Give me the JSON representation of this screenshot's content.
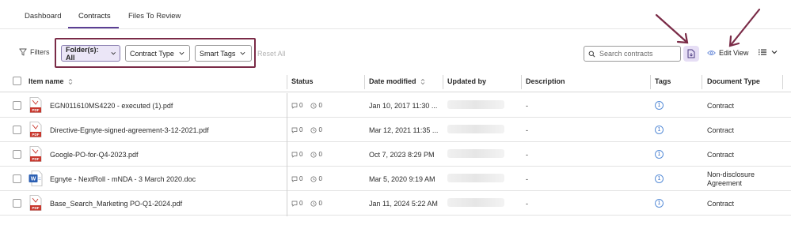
{
  "tabs": [
    {
      "label": "Dashboard"
    },
    {
      "label": "Contracts"
    },
    {
      "label": "Files To Review"
    }
  ],
  "toolbar": {
    "filters_label": "Filters",
    "folders_label": "Folder(s): All",
    "contract_type_label": "Contract Type",
    "smart_tags_label": "Smart Tags",
    "reset_label": "Reset All",
    "search_placeholder": "Search contracts",
    "edit_view_label": "Edit View"
  },
  "table": {
    "headers": {
      "item_name": "Item name",
      "status": "Status",
      "date_modified": "Date modified",
      "updated_by": "Updated by",
      "description": "Description",
      "tags": "Tags",
      "document_type": "Document Type"
    },
    "rows": [
      {
        "name": "EGN011610MS4220 - executed (1).pdf",
        "file_type": "PDF",
        "comments": "0",
        "tasks": "0",
        "date": "Jan 10, 2017 11:30 ...",
        "description": "-",
        "tag_count": "1",
        "document_type": "Contract"
      },
      {
        "name": "Directive-Egnyte-signed-agreement-3-12-2021.pdf",
        "file_type": "PDF",
        "comments": "0",
        "tasks": "0",
        "date": "Mar 12, 2021 11:35 ...",
        "description": "-",
        "tag_count": "1",
        "document_type": "Contract"
      },
      {
        "name": "Google-PO-for-Q4-2023.pdf",
        "file_type": "PDF",
        "comments": "0",
        "tasks": "0",
        "date": "Oct 7, 2023 8:29 PM",
        "description": "-",
        "tag_count": "1",
        "document_type": "Contract"
      },
      {
        "name": "Egnyte - NextRoll - mNDA - 3 March 2020.doc",
        "file_type": "W",
        "comments": "0",
        "tasks": "0",
        "date": "Mar 5, 2020 9:19 AM",
        "description": "-",
        "tag_count": "1",
        "document_type": "Non-disclosure Agreement"
      },
      {
        "name": "Base_Search_Marketing PO-Q1-2024.pdf",
        "file_type": "PDF",
        "comments": "0",
        "tasks": "0",
        "date": "Jan 11, 2024 5:22 AM",
        "description": "-",
        "tag_count": "1",
        "document_type": "Contract"
      }
    ]
  },
  "colors": {
    "accent": "#5b3f94",
    "highlight_box": "#7a2b47",
    "pdf_red": "#c8372d",
    "word_blue": "#2b5fb3",
    "tag_blue": "#3a6fc4"
  }
}
